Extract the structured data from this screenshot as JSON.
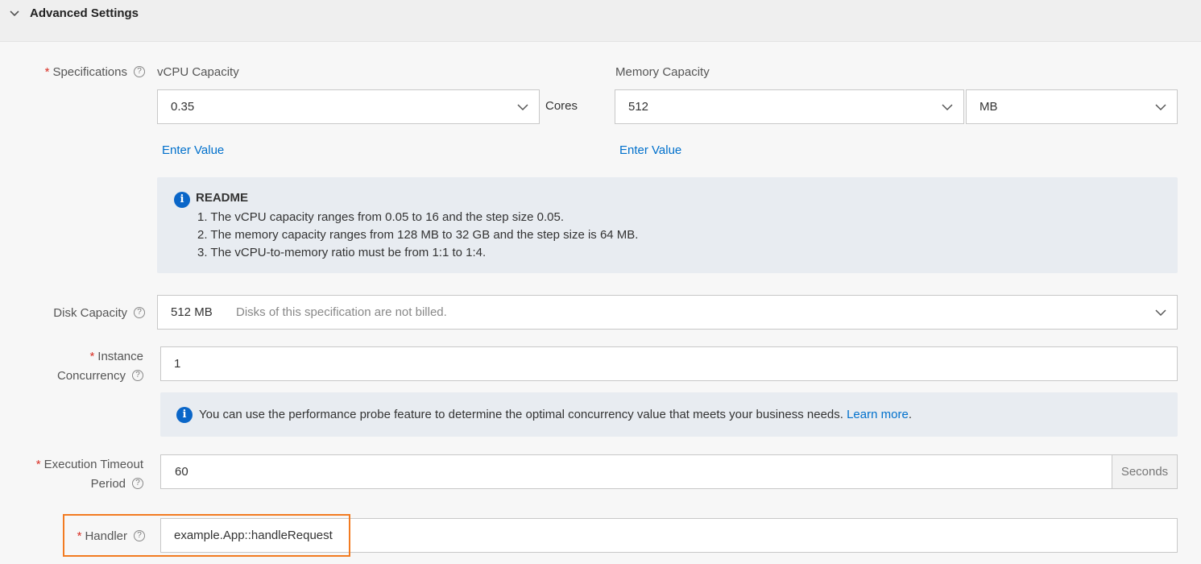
{
  "section": {
    "title": "Advanced Settings"
  },
  "specifications": {
    "label": "Specifications",
    "vcpu": {
      "label": "vCPU Capacity",
      "value": "0.35",
      "unit": "Cores",
      "enter_link": "Enter Value"
    },
    "memory": {
      "label": "Memory Capacity",
      "value": "512",
      "unit": "MB",
      "enter_link": "Enter Value"
    },
    "readme": {
      "title": "README",
      "lines": [
        "1. The vCPU capacity ranges from 0.05 to 16 and the step size 0.05.",
        "2. The memory capacity ranges from 128 MB to 32 GB and the step size is 64 MB.",
        "3. The vCPU-to-memory ratio must be from 1:1 to 1:4."
      ]
    }
  },
  "disk": {
    "label": "Disk Capacity",
    "value": "512 MB",
    "note": "Disks of this specification are not billed."
  },
  "concurrency": {
    "label_line1": "Instance",
    "label_line2": "Concurrency",
    "value": "1",
    "notice": "You can use the performance probe feature to determine the optimal concurrency value that meets your business needs.",
    "learn_more": "Learn more",
    "period": "."
  },
  "timeout": {
    "label_line1": "Execution Timeout",
    "label_line2": "Period",
    "value": "60",
    "unit": "Seconds"
  },
  "handler": {
    "label": "Handler",
    "value": "example.App::handleRequest"
  },
  "symbols": {
    "required": "*",
    "help": "?",
    "info": "i"
  },
  "colors": {
    "link": "#0070cc",
    "required": "#d93026",
    "highlight": "#f27b21",
    "info": "#0a66c8"
  }
}
